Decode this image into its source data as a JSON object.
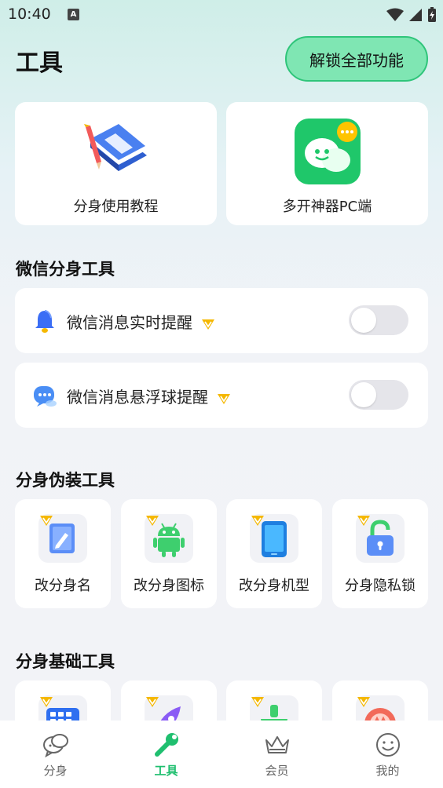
{
  "status_bar": {
    "time": "10:40",
    "notif_icon": "A"
  },
  "header": {
    "title": "工具",
    "unlock_label": "解锁全部功能"
  },
  "top_cards": [
    {
      "label": "分身使用教程",
      "icon": "book-icon"
    },
    {
      "label": "多开神器PC端",
      "icon": "chat-app-icon"
    }
  ],
  "wechat_section": {
    "title": "微信分身工具",
    "rows": [
      {
        "label": "微信消息实时提醒",
        "icon": "bell-icon",
        "enabled": false
      },
      {
        "label": "微信消息悬浮球提醒",
        "icon": "chat-bubble-icon",
        "enabled": false
      }
    ]
  },
  "disguise_section": {
    "title": "分身伪装工具",
    "items": [
      {
        "label": "改分身名",
        "icon": "edit-icon"
      },
      {
        "label": "改分身图标",
        "icon": "android-icon"
      },
      {
        "label": "改分身机型",
        "icon": "phone-icon"
      },
      {
        "label": "分身隐私锁",
        "icon": "lock-icon"
      }
    ]
  },
  "basic_section": {
    "title": "分身基础工具",
    "items": [
      {
        "icon": "keyboard-icon"
      },
      {
        "icon": "rocket-icon"
      },
      {
        "icon": "clean-icon"
      },
      {
        "icon": "speed-icon"
      }
    ]
  },
  "tabbar": {
    "tabs": [
      {
        "label": "分身",
        "icon": "chat-icon",
        "active": false
      },
      {
        "label": "工具",
        "icon": "tool-icon",
        "active": true
      },
      {
        "label": "会员",
        "icon": "crown-icon",
        "active": false
      },
      {
        "label": "我的",
        "icon": "smile-icon",
        "active": false
      }
    ]
  },
  "colors": {
    "accent": "#1fbf6f",
    "unlock_bg": "#7fe6b3",
    "vip_gold": "#f5b800"
  }
}
